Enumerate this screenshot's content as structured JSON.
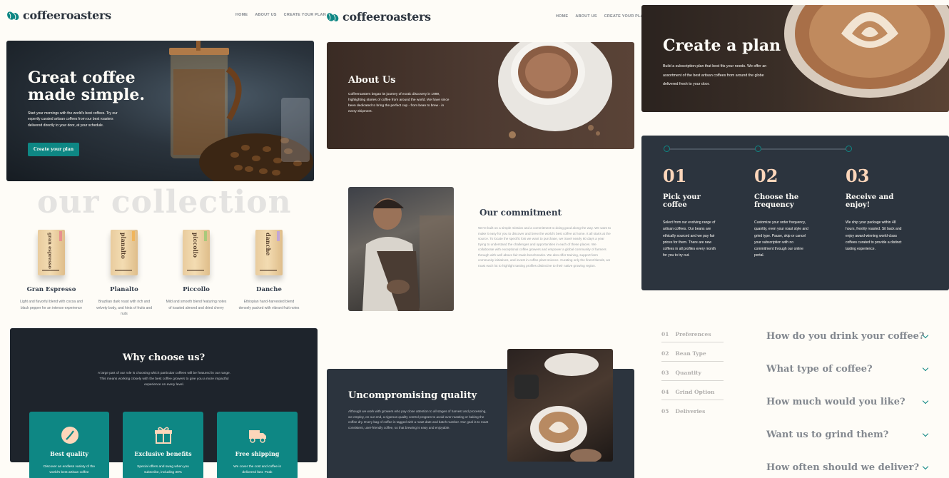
{
  "brand": {
    "name": "coffeeroasters"
  },
  "nav": {
    "home": "Home",
    "about": "About us",
    "plan": "Create your plan"
  },
  "hero": {
    "title_line1": "Great coffee",
    "title_line2": "made simple.",
    "text": "Start your mornings with the world's best coffees. Try our expertly curated artisan coffees from our best roasters delivered directly to your door, at your schedule.",
    "button": "Create your plan"
  },
  "collection": {
    "heading": "our collection",
    "products": [
      {
        "name": "Gran Espresso",
        "bag": "gran espresso",
        "desc": "Light and flavorful blend with cocoa and black pepper for an intense experience"
      },
      {
        "name": "Planalto",
        "bag": "planalto",
        "desc": "Brazilian dark roast with rich and velvety body, and hints of fruits and nuts"
      },
      {
        "name": "Piccollo",
        "bag": "piccollo",
        "desc": "Mild and smooth blend featuring notes of toasted almond and dried cherry"
      },
      {
        "name": "Danche",
        "bag": "danche",
        "desc": "Ethiopian hand-harvested blend densely packed with vibrant fruit notes"
      }
    ]
  },
  "why": {
    "title": "Why choose us?",
    "text": "A large part of our role is choosing which particular coffees will be featured in our range. This means working closely with the best coffee growers to give you a more impactful experience on every level.",
    "features": [
      {
        "icon": "coffee-bean-icon",
        "title": "Best quality",
        "text": "Discover an endless variety of the world's best artisan coffee"
      },
      {
        "icon": "gift-icon",
        "title": "Exclusive benefits",
        "text": "Special offers and swag when you subscribe, including 30%"
      },
      {
        "icon": "truck-icon",
        "title": "Free shipping",
        "text": "We cover the cost and coffee is delivered fast. Peak"
      }
    ]
  },
  "about": {
    "title": "About Us",
    "text": "Coffeeroasters began its journey of exotic discovery in 1999, highlighting stories of coffee from around the world. We have since been dedicated to bring the perfect cup - from bean to brew - in every shipment."
  },
  "commitment": {
    "title": "Our commitment",
    "text": "We're built on a simple mission and a commitment to doing good along the way. We want to make it easy for you to discover and brew the world's best coffee at home. It all starts at the source. To locate the specific lots we want to purchase, we travel nearly 60 days a year trying to understand the challenges and opportunities in each of these places. We collaborate with exceptional coffee growers and empower a global community of farmers through with well above fair-trade benchmarks. We also offer training, support farm community initiatives, and invest in coffee plant science. Curating only the finest blends, we roast each lot to highlight tasting profiles distinctive to their native growing region."
  },
  "quality": {
    "title": "Uncompromising quality",
    "text": "Although we work with growers who pay close attention to all stages of harvest and processing, we employ, on our end, a rigorous quality control program to avoid over-roasting or baking the coffee dry. Every bag of coffee is tagged with a roast date and batch number. Our goal is to roast consistent, user-friendly coffee, so that brewing is easy and enjoyable."
  },
  "plan": {
    "title": "Create a plan",
    "text": "Build a subscription plan that best fits your needs. We offer an assortment of the best artisan coffees from around the globe delivered fresh to your door."
  },
  "steps": [
    {
      "num": "01",
      "title": "Pick your coffee",
      "text": "Select from our evolving range of artisan coffees. Our beans are ethically sourced and we pay fair prices for them. There are new coffees in all profiles every month for you to try out."
    },
    {
      "num": "02",
      "title": "Choose the frequency",
      "text": "Customize your order frequency, quantity, even your roast style and grind type. Pause, skip or cancel your subscription with no commitment through our online portal."
    },
    {
      "num": "03",
      "title": "Receive and enjoy!",
      "text": "We ship your package within 48 hours, freshly roasted. Sit back and enjoy award-winning world-class coffees curated to provide a distinct tasting experience."
    }
  ],
  "plan_nav": [
    {
      "num": "01",
      "label": "Preferences"
    },
    {
      "num": "02",
      "label": "Bean Type"
    },
    {
      "num": "03",
      "label": "Quantity"
    },
    {
      "num": "04",
      "label": "Grind Option"
    },
    {
      "num": "05",
      "label": "Deliveries"
    }
  ],
  "questions": [
    "How do you drink your coffee?",
    "What type of coffee?",
    "How much would you like?",
    "Want us to grind them?",
    "How often should we deliver?"
  ],
  "colors": {
    "teal": "#0e8784",
    "dark": "#2c343e",
    "peach": "#fdd6ba",
    "cream": "#fefcf7"
  }
}
